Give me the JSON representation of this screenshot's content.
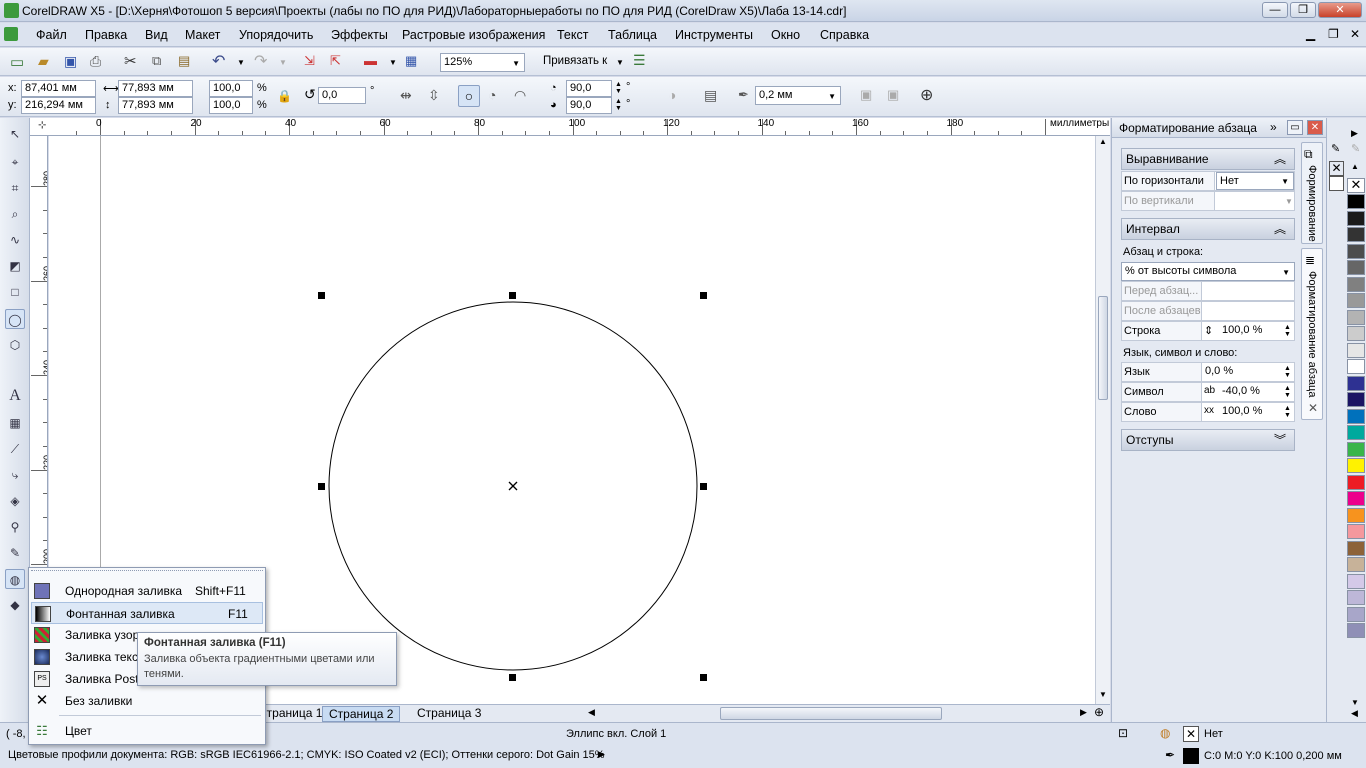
{
  "window": {
    "title": "CorelDRAW X5 - [D:\\Херня\\Фотошоп 5 версия\\Проекты (лабы по ПО для РИД)\\Лабораторныеработы по ПО для РИД (CorelDraw X5)\\Лаба 13-14.cdr]",
    "minimize": "—",
    "maximize": "❐",
    "close": "✕"
  },
  "menu": [
    "Файл",
    "Правка",
    "Вид",
    "Макет",
    "Упорядочить",
    "Эффекты",
    "Растровые изображения",
    "Текст",
    "Таблица",
    "Инструменты",
    "Окно",
    "Справка"
  ],
  "toolbar1": {
    "zoom": "125%",
    "snap": "Привязать к"
  },
  "propbar": {
    "x": "87,401 мм",
    "y": "216,294 мм",
    "w": "77,893 мм",
    "h": "77,893 мм",
    "scale_x": "100,0",
    "scale_y": "100,0",
    "percent": "%",
    "rotation": "0,0",
    "degree": "°",
    "start_angle": "90,0",
    "end_angle": "90,0",
    "outline": "0,2 мм",
    "x_label": "x:",
    "y_label": "y:"
  },
  "ruler": {
    "h_ticks": [
      "0",
      "20",
      "40",
      "60",
      "80",
      "100",
      "120",
      "140",
      "160",
      "180"
    ],
    "unit": "миллиметры",
    "v_ticks": [
      "280",
      "260",
      "240",
      "220",
      "200"
    ]
  },
  "pages": [
    "Страница 1",
    "Страница 2",
    "Страница 3"
  ],
  "active_page": "Страница 2",
  "docker": {
    "title": "Форматирование абзаца",
    "align_section": "Выравнивание",
    "horiz_label": "По горизонтали",
    "horiz_value": "Нет",
    "vert_label": "По вертикали",
    "interval_section": "Интервал",
    "para_line_label": "Абзац и строка:",
    "para_line_value": "% от высоты символа",
    "before_label": "Перед абзац...",
    "after_label": "После абзацев",
    "line_label": "Строка",
    "line_value": "100,0 %",
    "lang_section_label": "Язык, символ и слово:",
    "lang_label": "Язык",
    "lang_value": "0,0 %",
    "char_label": "Символ",
    "char_value": "-40,0 %",
    "word_label": "Слово",
    "word_value": "100,0 %",
    "indent_section": "Отступы",
    "vtab1": "Формирование",
    "vtab2": "Форматирование абзаца"
  },
  "palette_colors": [
    "#000000",
    "#1a1a1a",
    "#333333",
    "#4d4d4d",
    "#666666",
    "#808080",
    "#999999",
    "#b3b3b3",
    "#cccccc",
    "#e6e6e6",
    "#ffffff",
    "#2e3192",
    "#1b1464",
    "#0071bc",
    "#00a99d",
    "#39b54a",
    "#fff200",
    "#ed1c24",
    "#ec008c",
    "#f7931e",
    "#f5989d",
    "#8c6239",
    "#c7b299",
    "#d4c9e8",
    "#bdb7d8",
    "#a8a6c9",
    "#8f8fb6"
  ],
  "flyout": [
    {
      "label": "Однородная заливка",
      "shortcut": "Shift+F11",
      "icon": "uniform-fill-icon"
    },
    {
      "label": "Фонтанная заливка",
      "shortcut": "F11",
      "icon": "fountain-fill-icon"
    },
    {
      "label": "Заливка узор",
      "shortcut": "",
      "icon": "pattern-fill-icon"
    },
    {
      "label": "Заливка текст",
      "shortcut": "",
      "icon": "texture-fill-icon"
    },
    {
      "label": "Заливка Post",
      "shortcut": "",
      "icon": "postscript-fill-icon"
    },
    {
      "label": "Без заливки",
      "shortcut": "",
      "icon": "no-fill-icon"
    },
    {
      "label": "Цвет",
      "shortcut": "",
      "icon": "color-icon"
    }
  ],
  "tooltip": {
    "title": "Фонтанная заливка (F11)",
    "body": "Заливка объекта градиентными цветами или тенями."
  },
  "status": {
    "coords": "( -8,",
    "object": "Эллипс вкл. Слой 1",
    "fill": "Нет",
    "outline": "C:0 M:0 Y:0 K:100  0,200 мм",
    "profiles": "Цветовые профили документа: RGB: sRGB IEC61966-2.1; CMYK: ISO Coated v2 (ECI); Оттенки серого: Dot Gain 15%"
  }
}
